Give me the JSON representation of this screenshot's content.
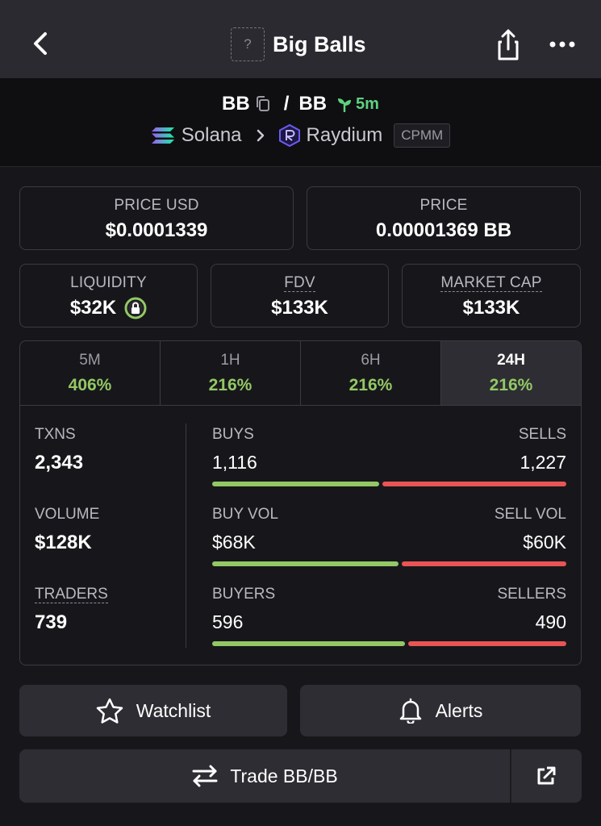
{
  "header": {
    "title": "Big Balls",
    "token_placeholder": "?"
  },
  "pair": {
    "base": "BB",
    "slash": "/",
    "quote": "BB",
    "age": "5m",
    "chain": "Solana",
    "dex": "Raydium",
    "pool_type": "CPMM"
  },
  "cards": {
    "price_usd": {
      "label": "PRICE USD",
      "value": "$0.0001339"
    },
    "price": {
      "label": "PRICE",
      "value": "0.00001369 BB"
    },
    "liquidity": {
      "label": "LIQUIDITY",
      "value": "$32K"
    },
    "fdv": {
      "label": "FDV",
      "value": "$133K"
    },
    "market_cap": {
      "label": "MARKET CAP",
      "value": "$133K"
    }
  },
  "tabs": [
    {
      "label": "5M",
      "value": "406%"
    },
    {
      "label": "1H",
      "value": "216%"
    },
    {
      "label": "6H",
      "value": "216%"
    },
    {
      "label": "24H",
      "value": "216%"
    }
  ],
  "stats": {
    "txns": {
      "label": "TXNS",
      "value": "2,343"
    },
    "volume": {
      "label": "VOLUME",
      "value": "$128K"
    },
    "traders": {
      "label": "TRADERS",
      "value": "739"
    },
    "buys": {
      "label": "BUYS",
      "value": "1,116",
      "count": 1116
    },
    "sells": {
      "label": "SELLS",
      "value": "1,227",
      "count": 1227
    },
    "buy_vol": {
      "label": "BUY VOL",
      "value": "$68K",
      "amount": 68
    },
    "sell_vol": {
      "label": "SELL VOL",
      "value": "$60K",
      "amount": 60
    },
    "buyers": {
      "label": "BUYERS",
      "value": "596",
      "count": 596
    },
    "sellers": {
      "label": "SELLERS",
      "value": "490",
      "count": 490
    }
  },
  "actions": {
    "watchlist": "Watchlist",
    "alerts": "Alerts",
    "trade": "Trade BB/BB"
  },
  "colors": {
    "positive": "#93c865",
    "negative": "#ea5455",
    "age": "#5fd17e"
  }
}
